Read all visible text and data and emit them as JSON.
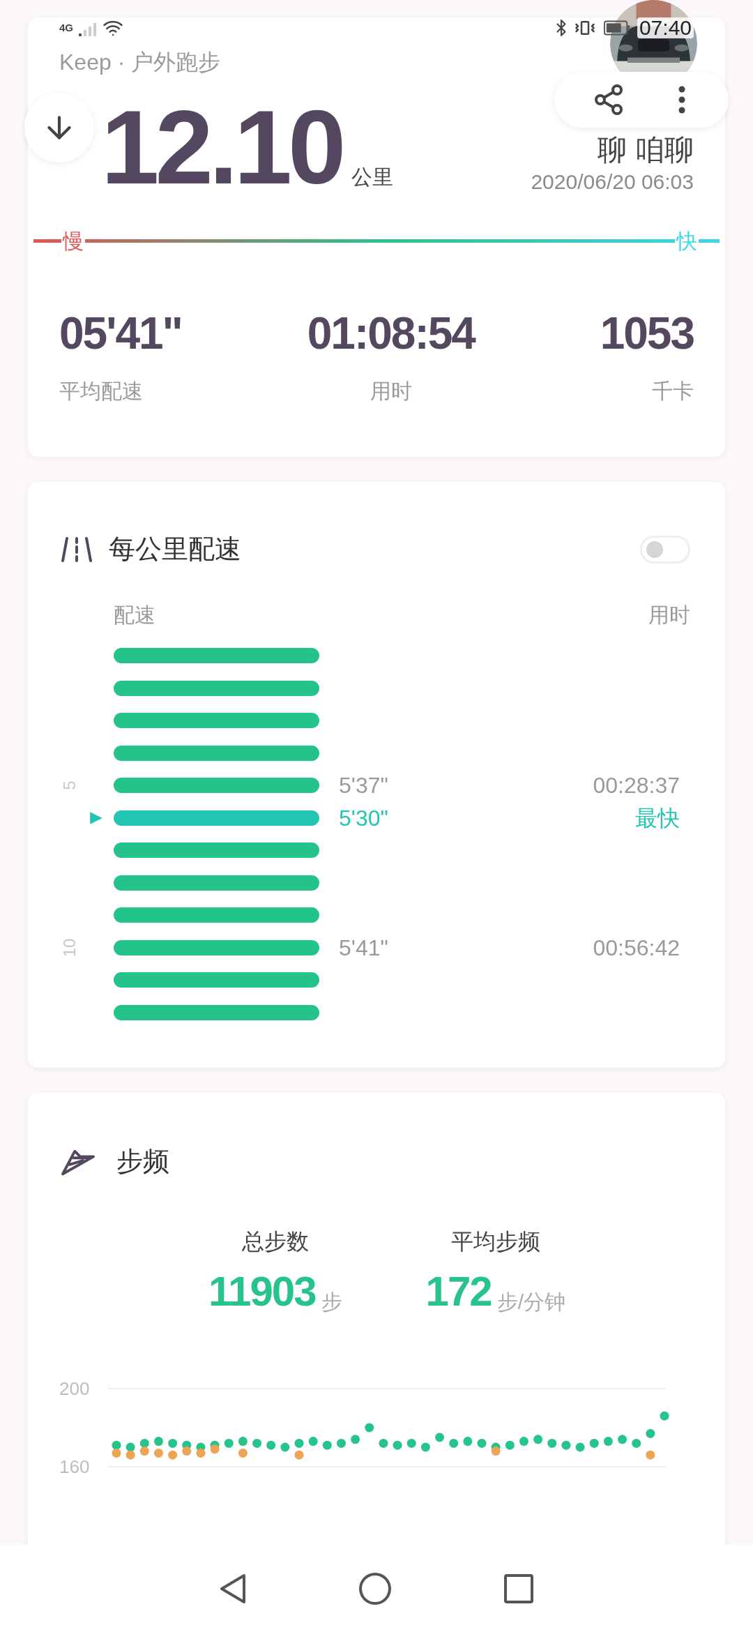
{
  "status_bar": {
    "network": "4G",
    "time": "07:40"
  },
  "summary": {
    "source": "Keep · 户外跑步",
    "distance": "12.10",
    "distance_unit": "公里",
    "nickname": "聊 咱聊",
    "date": "2020/06/20 06:03",
    "slow_label": "慢",
    "fast_label": "快",
    "stats": [
      {
        "value": "05'41\"",
        "label": "平均配速"
      },
      {
        "value": "01:08:54",
        "label": "用时"
      },
      {
        "value": "1053",
        "label": "千卡"
      }
    ]
  },
  "pace": {
    "title": "每公里配速",
    "toggle": {
      "on": false
    },
    "pace_header": "配速",
    "time_header": "用时",
    "rows": [
      {
        "fastest": false
      },
      {
        "fastest": false
      },
      {
        "fastest": false
      },
      {
        "fastest": false
      },
      {
        "fastest": false,
        "axis_label": "5",
        "pace": "5'37\"",
        "time": "00:28:37"
      },
      {
        "fastest": true,
        "pace": "5'30\"",
        "badge": "最快"
      },
      {
        "fastest": false
      },
      {
        "fastest": false
      },
      {
        "fastest": false
      },
      {
        "fastest": false,
        "axis_label": "10",
        "pace": "5'41\"",
        "time": "00:56:42"
      },
      {
        "fastest": false
      },
      {
        "fastest": false
      }
    ]
  },
  "cadence": {
    "title": "步频",
    "stats": [
      {
        "label": "总步数",
        "value": "11903",
        "unit": "步"
      },
      {
        "label": "平均步频",
        "value": "172",
        "unit": "步/分钟"
      }
    ],
    "chart_data": {
      "type": "scatter",
      "categories": [
        null,
        null,
        null,
        null,
        null,
        null,
        null,
        null,
        null,
        null,
        null,
        null,
        null,
        null,
        null,
        null,
        null,
        null,
        null,
        null,
        null,
        null,
        null,
        null,
        null,
        null,
        null,
        null,
        null,
        null,
        null,
        null,
        null,
        null,
        null,
        null,
        null,
        null,
        null,
        null
      ],
      "ylim": [
        160,
        200
      ],
      "yticks": [
        160,
        200
      ],
      "series": [
        {
          "color": "#26c48a",
          "values": [
            171,
            170,
            172,
            173,
            172,
            171,
            170,
            171,
            172,
            173,
            172,
            171,
            170,
            172,
            173,
            171,
            172,
            174,
            180,
            172,
            171,
            172,
            170,
            175,
            172,
            173,
            172,
            170,
            171,
            173,
            174,
            172,
            171,
            170,
            172,
            173,
            174,
            172,
            177,
            186
          ]
        },
        {
          "color": "#eea455",
          "values": [
            167,
            166,
            168,
            167,
            166,
            168,
            167,
            169,
            null,
            167,
            null,
            null,
            null,
            166,
            null,
            null,
            null,
            null,
            null,
            null,
            null,
            null,
            null,
            null,
            null,
            null,
            null,
            168,
            null,
            null,
            null,
            null,
            null,
            null,
            null,
            null,
            null,
            null,
            166,
            null
          ]
        }
      ]
    }
  }
}
